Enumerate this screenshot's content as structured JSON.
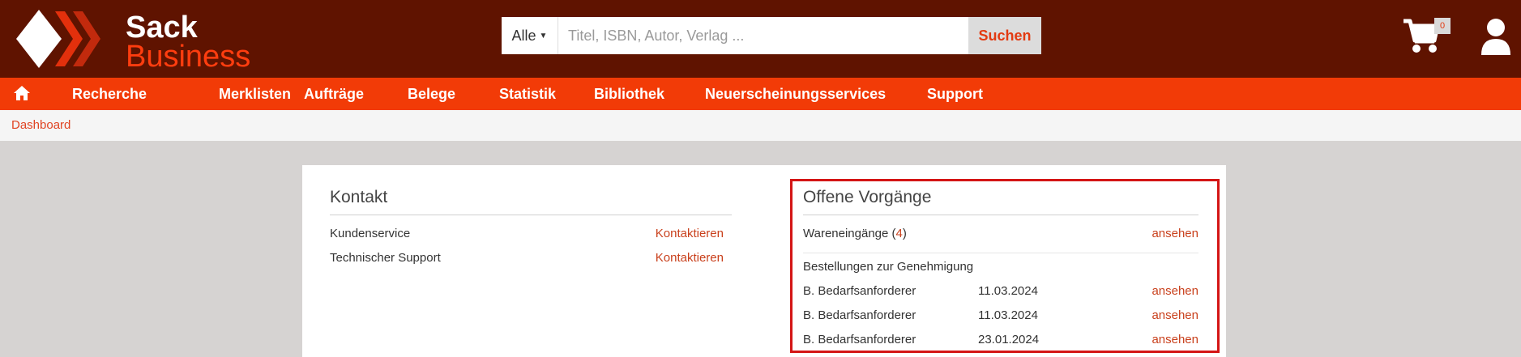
{
  "header": {
    "logo_line1": "Sack",
    "logo_line2": "Business",
    "search": {
      "scope": "Alle",
      "placeholder": "Titel, ISBN, Autor, Verlag ...",
      "button_label": "Suchen"
    },
    "cart_count": "0",
    "icons": [
      "logo-icon",
      "cart-icon",
      "user-icon"
    ]
  },
  "nav": {
    "home_icon": "home-icon",
    "items": [
      "Recherche",
      "Merklisten",
      "Aufträge",
      "Belege",
      "Statistik",
      "Bibliothek",
      "Neuerscheinungsservices",
      "Support"
    ]
  },
  "breadcrumb": "Dashboard",
  "kontakt": {
    "title": "Kontakt",
    "rows": [
      {
        "label": "Kundenservice",
        "link": "Kontaktieren"
      },
      {
        "label": "Technischer Support",
        "link": "Kontaktieren"
      }
    ]
  },
  "offene": {
    "title": "Offene Vorgänge",
    "wareneingaenge": {
      "label": "Wareneingänge",
      "count": "4",
      "link": "ansehen"
    },
    "genehmigung_title": "Bestellungen zur Genehmigung",
    "orders": [
      {
        "name": "B. Bedarfsanforderer",
        "date": "11.03.2024",
        "link": "ansehen"
      },
      {
        "name": "B. Bedarfsanforderer",
        "date": "11.03.2024",
        "link": "ansehen"
      },
      {
        "name": "B. Bedarfsanforderer",
        "date": "23.01.2024",
        "link": "ansehen"
      }
    ]
  },
  "colors": {
    "header_bg": "#5f1300",
    "nav_bg": "#f23b07",
    "accent": "#e33a11",
    "highlight_border": "#d41515"
  }
}
